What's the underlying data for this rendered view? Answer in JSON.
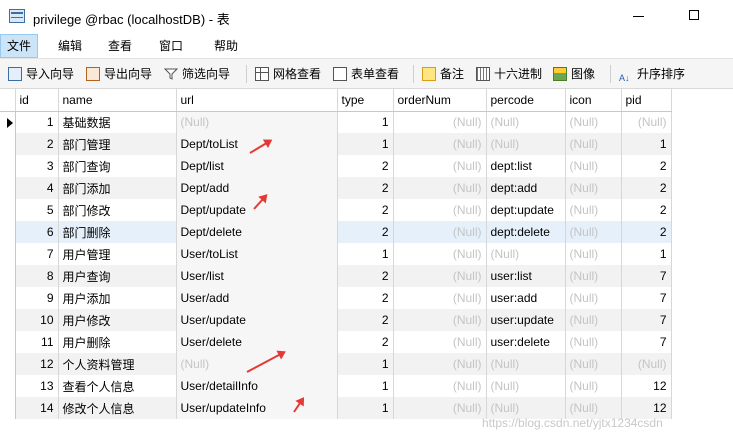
{
  "window": {
    "title": "privilege @rbac (localhostDB) - 表"
  },
  "menu": [
    {
      "label": "文件",
      "active": true
    },
    {
      "label": "编辑",
      "active": false
    },
    {
      "label": "查看",
      "active": false
    },
    {
      "label": "窗口",
      "active": false
    },
    {
      "label": "帮助",
      "active": false
    }
  ],
  "toolbar": {
    "import_wizard": "导入向导",
    "export_wizard": "导出向导",
    "filter_wizard": "筛选向导",
    "grid_view": "网格查看",
    "form_view": "表单查看",
    "memo": "备注",
    "hex": "十六进制",
    "image": "图像",
    "sort": "升序排序"
  },
  "table": {
    "columns": [
      "id",
      "name",
      "url",
      "type",
      "orderNum",
      "percode",
      "icon",
      "pid"
    ],
    "rows": [
      [
        "1",
        "基础数据",
        "(Null)",
        "1",
        "(Null)",
        "(Null)",
        "(Null)",
        "(Null)"
      ],
      [
        "2",
        "部门管理",
        "Dept/toList",
        "1",
        "(Null)",
        "(Null)",
        "(Null)",
        "1"
      ],
      [
        "3",
        "部门查询",
        "Dept/list",
        "2",
        "(Null)",
        "dept:list",
        "(Null)",
        "2"
      ],
      [
        "4",
        "部门添加",
        "Dept/add",
        "2",
        "(Null)",
        "dept:add",
        "(Null)",
        "2"
      ],
      [
        "5",
        "部门修改",
        "Dept/update",
        "2",
        "(Null)",
        "dept:update",
        "(Null)",
        "2"
      ],
      [
        "6",
        "部门删除",
        "Dept/delete",
        "2",
        "(Null)",
        "dept:delete",
        "(Null)",
        "2"
      ],
      [
        "7",
        "用户管理",
        "User/toList",
        "1",
        "(Null)",
        "(Null)",
        "(Null)",
        "1"
      ],
      [
        "8",
        "用户查询",
        "User/list",
        "2",
        "(Null)",
        "user:list",
        "(Null)",
        "7"
      ],
      [
        "9",
        "用户添加",
        "User/add",
        "2",
        "(Null)",
        "user:add",
        "(Null)",
        "7"
      ],
      [
        "10",
        "用户修改",
        "User/update",
        "2",
        "(Null)",
        "user:update",
        "(Null)",
        "7"
      ],
      [
        "11",
        "用户删除",
        "User/delete",
        "2",
        "(Null)",
        "user:delete",
        "(Null)",
        "7"
      ],
      [
        "12",
        "个人资料管理",
        "(Null)",
        "1",
        "(Null)",
        "(Null)",
        "(Null)",
        "(Null)"
      ],
      [
        "13",
        "查看个人信息",
        "User/detailInfo",
        "1",
        "(Null)",
        "(Null)",
        "(Null)",
        "12"
      ],
      [
        "14",
        "修改个人信息",
        "User/updateInfo",
        "1",
        "(Null)",
        "(Null)",
        "(Null)",
        "12"
      ]
    ]
  },
  "watermark": "https://blog.csdn.net/yjtx1234csdn",
  "colors": {
    "accent": "#e53935",
    "null_text": "#c4c4c4",
    "selected_row": "#e5f0fb"
  }
}
